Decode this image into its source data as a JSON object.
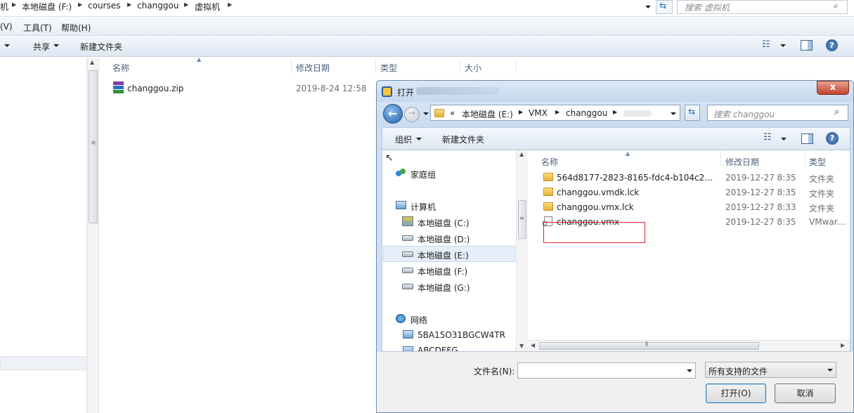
{
  "explorer": {
    "breadcrumbs": [
      "机",
      "本地磁盘 (F:)",
      "courses",
      "changgou",
      "虚拟机"
    ],
    "search_placeholder": "搜索 虚拟机",
    "menu": [
      "(V)",
      "工具(T)",
      "帮助(H)"
    ],
    "toolbar": {
      "share": "共享",
      "new_folder": "新建文件夹"
    },
    "columns": {
      "name": "名称",
      "modified": "修改日期",
      "type": "类型",
      "size": "大小"
    },
    "files": [
      {
        "name": "changgou.zip",
        "modified": "2019-8-24 12:58",
        "icon": "winrar-archive-icon"
      }
    ]
  },
  "dialog": {
    "title": "打开",
    "close": "x",
    "path": [
      "«",
      "本地磁盘 (E:)",
      "VMX",
      "changgou"
    ],
    "search_placeholder": "搜索 changgou",
    "toolbar": {
      "organize": "组织",
      "new_folder": "新建文件夹"
    },
    "tree": {
      "homegroup": "家庭组",
      "computer": "计算机",
      "drives": [
        "本地磁盘 (C:)",
        "本地磁盘 (D:)",
        "本地磁盘 (E:)",
        "本地磁盘 (F:)",
        "本地磁盘 (G:)"
      ],
      "selected_drive": "本地磁盘 (E:)",
      "network": "网络",
      "network_items": [
        "5BA15O31BGCW4TR",
        "ABCDEFG"
      ]
    },
    "columns": {
      "name": "名称",
      "modified": "修改日期",
      "type": "类型"
    },
    "files": [
      {
        "name": "564d8177-2823-8165-fdc4-b104c24d...",
        "modified": "2019-12-27 8:35",
        "type": "文件夹",
        "icon": "folder-icon"
      },
      {
        "name": "changgou.vmdk.lck",
        "modified": "2019-12-27 8:35",
        "type": "文件夹",
        "icon": "folder-icon"
      },
      {
        "name": "changgou.vmx.lck",
        "modified": "2019-12-27 8:33",
        "type": "文件夹",
        "icon": "folder-icon"
      },
      {
        "name": "changgou.vmx",
        "modified": "2019-12-27 8:35",
        "type": "VMware ...",
        "icon": "vmx-file-icon"
      }
    ],
    "filename_label": "文件名(N):",
    "filename_value": "",
    "filter": "所有支持的文件",
    "open_button": "打开(O)",
    "cancel_button": "取消",
    "highlight_color": "#d9262f",
    "selection_color": "#e5eef9"
  }
}
